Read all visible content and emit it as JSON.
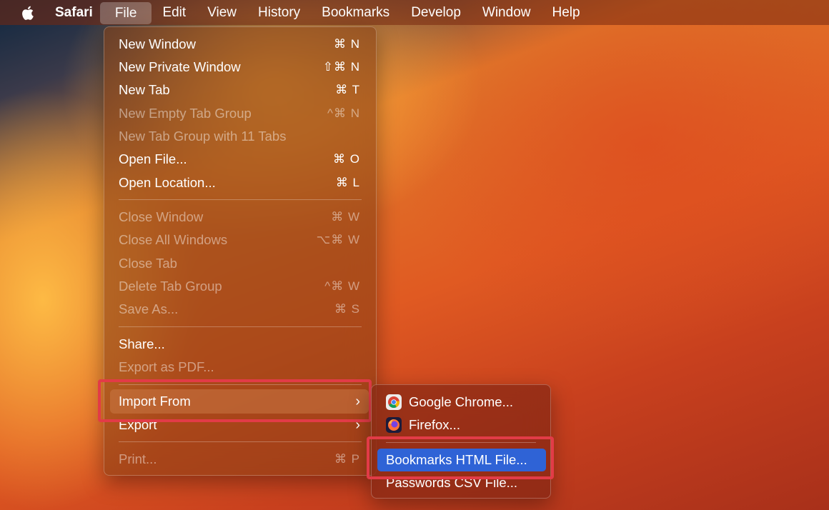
{
  "menubar": {
    "app": "Safari",
    "items": [
      "File",
      "Edit",
      "View",
      "History",
      "Bookmarks",
      "Develop",
      "Window",
      "Help"
    ]
  },
  "file_menu": {
    "items": [
      {
        "label": "New Window",
        "shortcut": "⌘ N",
        "enabled": true
      },
      {
        "label": "New Private Window",
        "shortcut": "⇧⌘ N",
        "enabled": true
      },
      {
        "label": "New Tab",
        "shortcut": "⌘ T",
        "enabled": true
      },
      {
        "label": "New Empty Tab Group",
        "shortcut": "^⌘ N",
        "enabled": false
      },
      {
        "label": "New Tab Group with 11 Tabs",
        "shortcut": "",
        "enabled": false
      },
      {
        "label": "Open File...",
        "shortcut": "⌘ O",
        "enabled": true
      },
      {
        "label": "Open Location...",
        "shortcut": "⌘ L",
        "enabled": true
      },
      {
        "label": "Close Window",
        "shortcut": "⌘ W",
        "enabled": false
      },
      {
        "label": "Close All Windows",
        "shortcut": "⌥⌘ W",
        "enabled": false
      },
      {
        "label": "Close Tab",
        "shortcut": "",
        "enabled": false
      },
      {
        "label": "Delete Tab Group",
        "shortcut": "^⌘ W",
        "enabled": false
      },
      {
        "label": "Save As...",
        "shortcut": "⌘ S",
        "enabled": false
      },
      {
        "label": "Share...",
        "shortcut": "",
        "enabled": true
      },
      {
        "label": "Export as PDF...",
        "shortcut": "",
        "enabled": false
      },
      {
        "label": "Import From",
        "shortcut": "",
        "enabled": true
      },
      {
        "label": "Export",
        "shortcut": "",
        "enabled": true
      },
      {
        "label": "Print...",
        "shortcut": "⌘ P",
        "enabled": false
      }
    ],
    "submenu_chevron": "›"
  },
  "import_submenu": {
    "items": [
      {
        "label": "Google Chrome..."
      },
      {
        "label": "Firefox..."
      },
      {
        "label": "Bookmarks HTML File..."
      },
      {
        "label": "Passwords CSV File..."
      }
    ]
  },
  "colors": {
    "highlight_box": "#e23b47",
    "selection": "#2f63d6"
  },
  "icons": {
    "apple": "apple-logo-icon",
    "chrome": "chrome-icon",
    "firefox": "firefox-icon"
  }
}
